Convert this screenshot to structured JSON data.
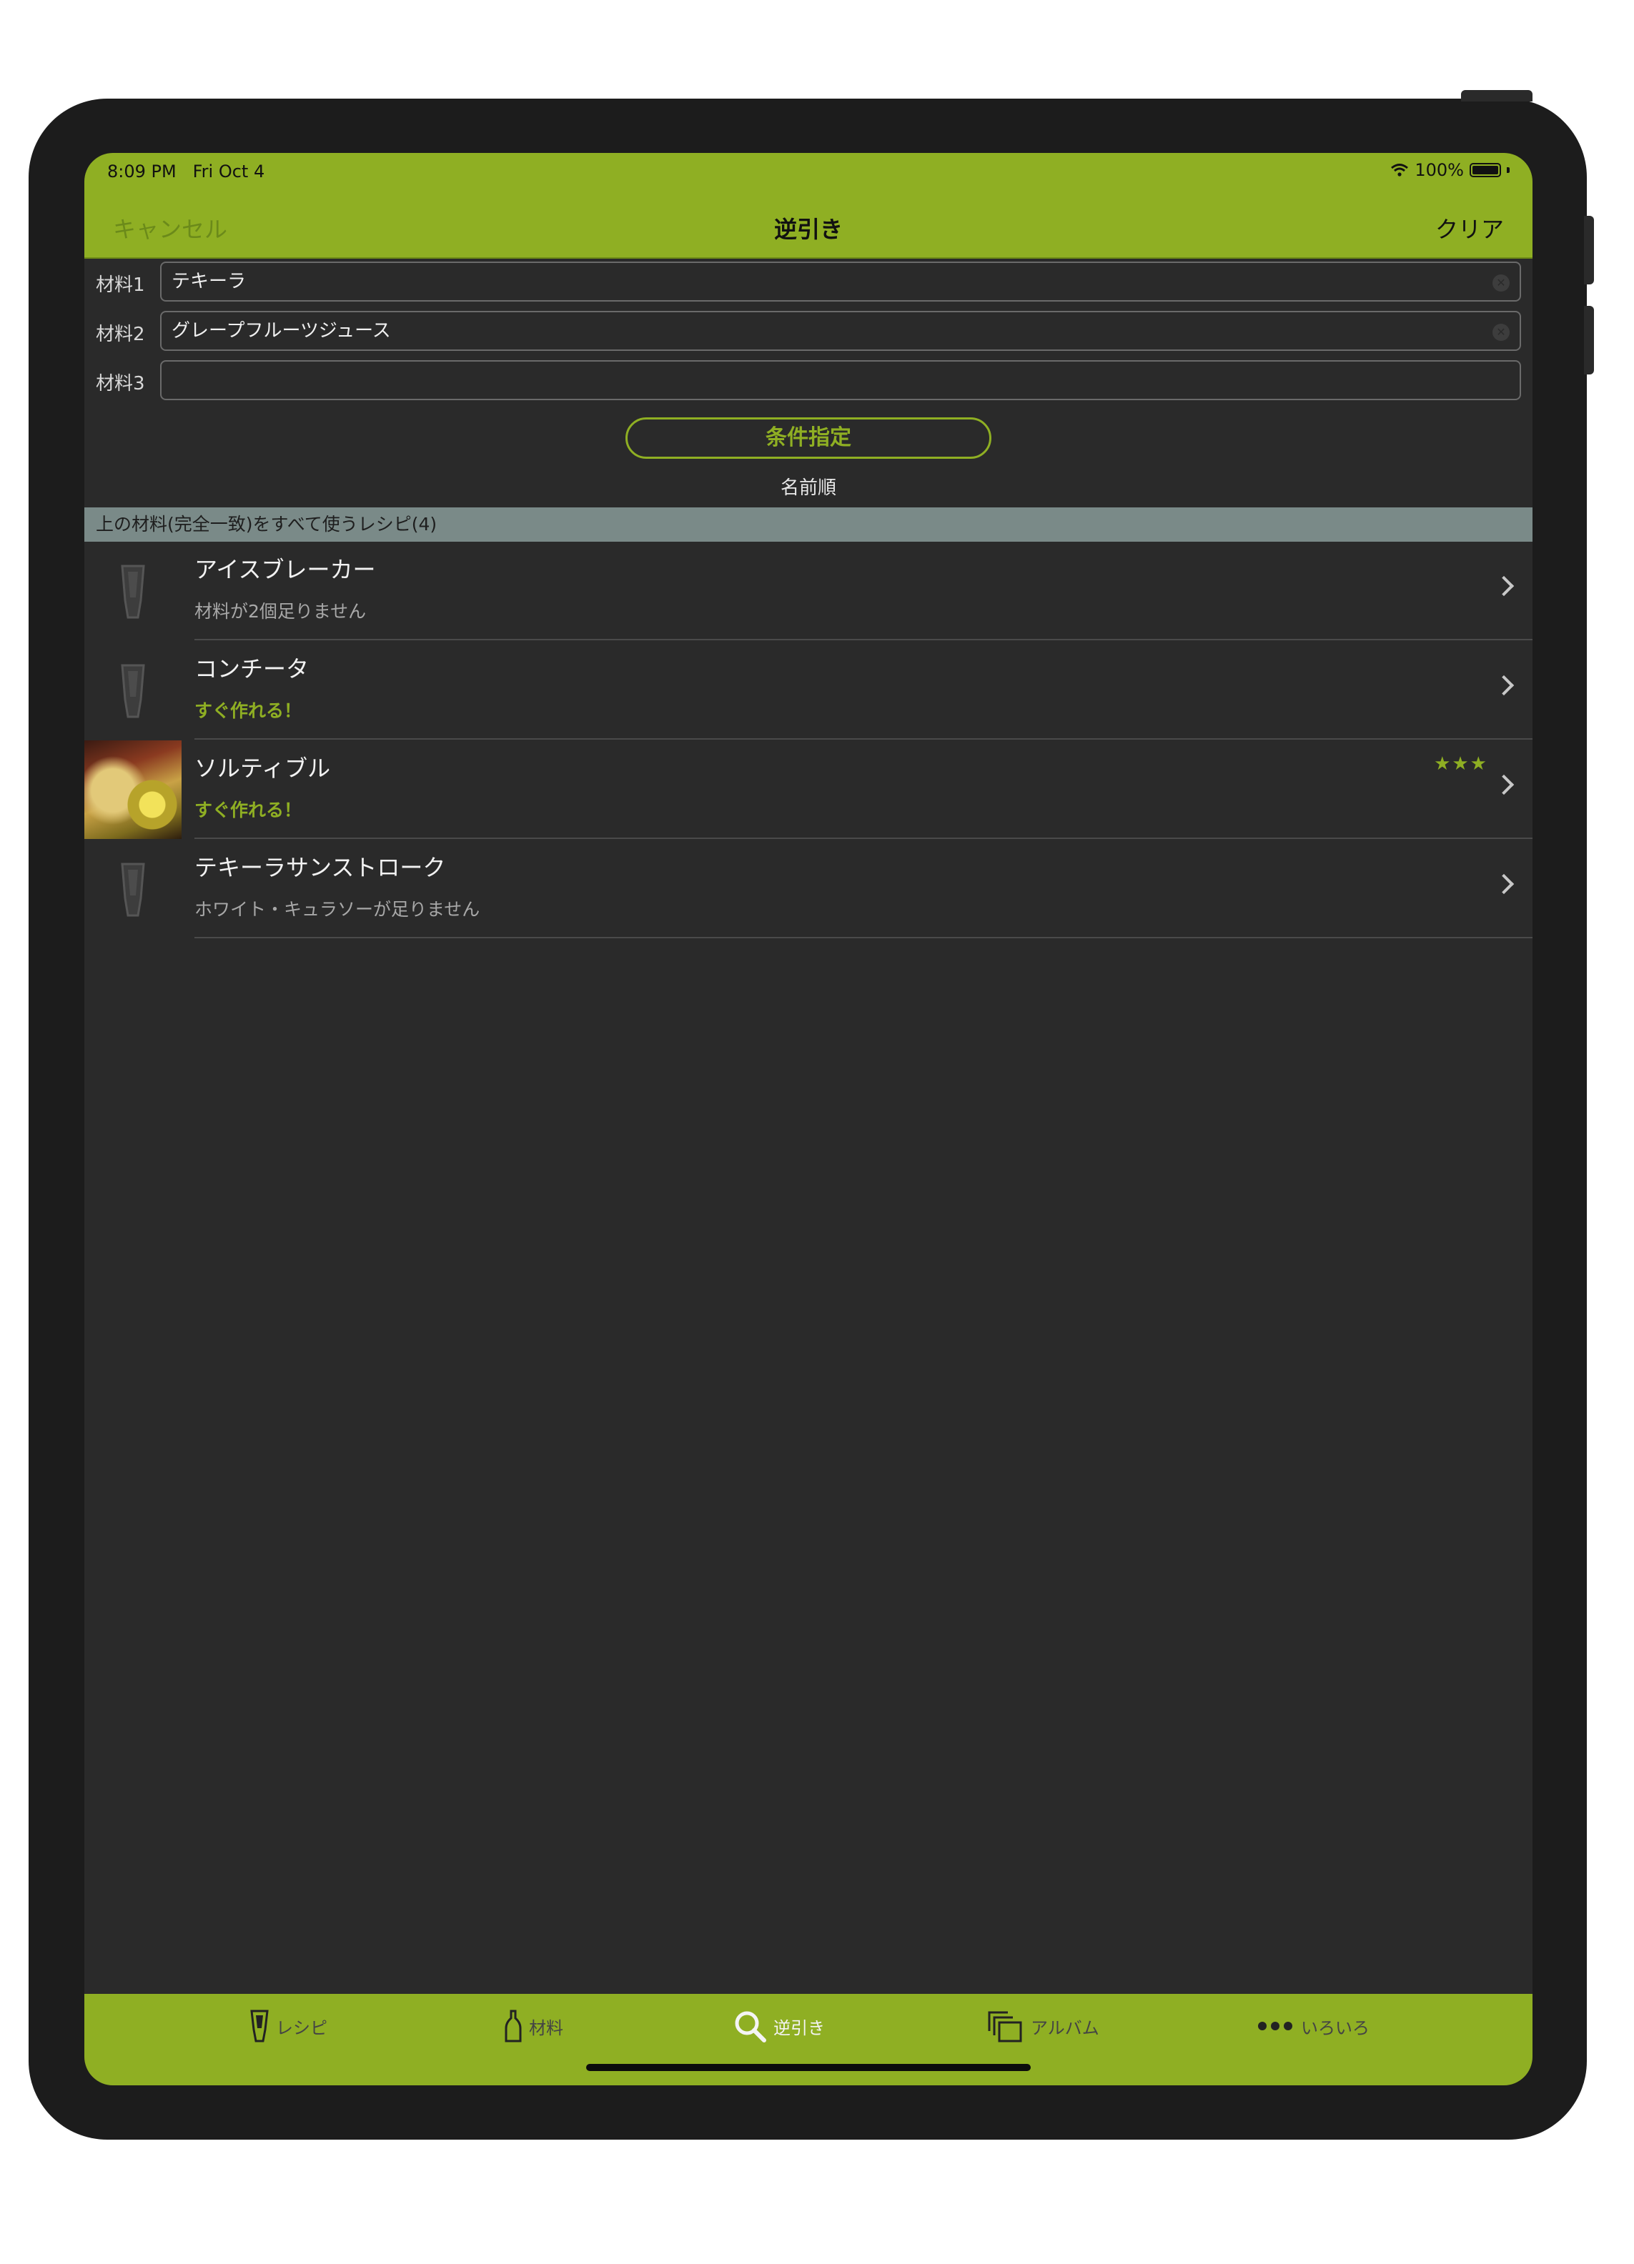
{
  "status": {
    "time": "8:09 PM",
    "date": "Fri Oct 4",
    "battery": "100%"
  },
  "nav": {
    "cancel": "キャンセル",
    "title": "逆引き",
    "clear": "クリア"
  },
  "fields": [
    {
      "label": "材料1",
      "value": "テキーラ"
    },
    {
      "label": "材料2",
      "value": "グレープフルーツジュース"
    },
    {
      "label": "材料3",
      "value": ""
    }
  ],
  "condition_button": "条件指定",
  "sort_label": "名前順",
  "section_header": "上の材料(完全一致)をすべて使うレシピ(4)",
  "recipes": [
    {
      "name": "アイスブレーカー",
      "status": "材料が2個足りません",
      "ready": false,
      "stars": "",
      "has_photo": false
    },
    {
      "name": "コンチータ",
      "status": "すぐ作れる！",
      "ready": true,
      "stars": "",
      "has_photo": false
    },
    {
      "name": "ソルティブル",
      "status": "すぐ作れる！",
      "ready": true,
      "stars": "★★★",
      "has_photo": true
    },
    {
      "name": "テキーラサンストローク",
      "status": "ホワイト・キュラソーが足りません",
      "ready": false,
      "stars": "",
      "has_photo": false
    }
  ],
  "tabs": [
    {
      "label": "レシピ",
      "icon": "glass-icon",
      "active": false
    },
    {
      "label": "材料",
      "icon": "bottle-icon",
      "active": false
    },
    {
      "label": "逆引き",
      "icon": "search-icon",
      "active": true
    },
    {
      "label": "アルバム",
      "icon": "album-icon",
      "active": false
    },
    {
      "label": "いろいろ",
      "icon": "more-icon",
      "active": false
    }
  ],
  "colors": {
    "accent": "#8faf23",
    "background": "#2a2a2a",
    "section": "#7a8a88"
  }
}
